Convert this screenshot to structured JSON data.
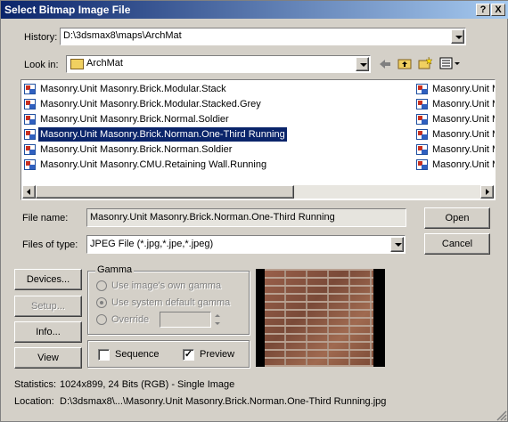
{
  "window": {
    "title": "Select Bitmap Image File",
    "help_button": "?",
    "close_button": "X"
  },
  "history": {
    "label": "History:",
    "value": "D:\\3dsmax8\\maps\\ArchMat"
  },
  "look_in": {
    "label": "Look in:",
    "value": "ArchMat"
  },
  "files": {
    "col1": [
      "Masonry.Unit Masonry.Brick.Modular.Stack",
      "Masonry.Unit Masonry.Brick.Modular.Stacked.Grey",
      "Masonry.Unit Masonry.Brick.Normal.Soldier",
      "Masonry.Unit Masonry.Brick.Norman.One-Third Running",
      "Masonry.Unit Masonry.Brick.Norman.Soldier",
      "Masonry.Unit Masonry.CMU.Retaining Wall.Running"
    ],
    "col2": [
      "Masonry.Unit M",
      "Masonry.Unit M",
      "Masonry.Unit M",
      "Masonry.Unit M",
      "Masonry.Unit M",
      "Masonry.Unit M"
    ],
    "selected_index": 3
  },
  "file_name": {
    "label": "File name:",
    "value": "Masonry.Unit Masonry.Brick.Norman.One-Third Running"
  },
  "files_of_type": {
    "label": "Files of type:",
    "value": "JPEG File (*.jpg,*.jpe,*.jpeg)"
  },
  "buttons": {
    "open": "Open",
    "cancel": "Cancel",
    "devices": "Devices...",
    "setup": "Setup...",
    "info": "Info...",
    "view": "View"
  },
  "gamma": {
    "title": "Gamma",
    "use_own": "Use image's own gamma",
    "use_system": "Use system default gamma",
    "override": "Override",
    "override_value": ""
  },
  "options": {
    "sequence": "Sequence",
    "sequence_checked": false,
    "preview": "Preview",
    "preview_checked": true
  },
  "statistics": {
    "label": "Statistics:",
    "value": "1024x899, 24 Bits (RGB) - Single Image"
  },
  "location": {
    "label": "Location:",
    "value": "D:\\3dsmax8\\...\\Masonry.Unit Masonry.Brick.Norman.One-Third Running.jpg"
  },
  "colors": {
    "titlebar_start": "#0a246a",
    "titlebar_end": "#a6caf0",
    "selection": "#0a246a",
    "face": "#d4d0c8"
  }
}
